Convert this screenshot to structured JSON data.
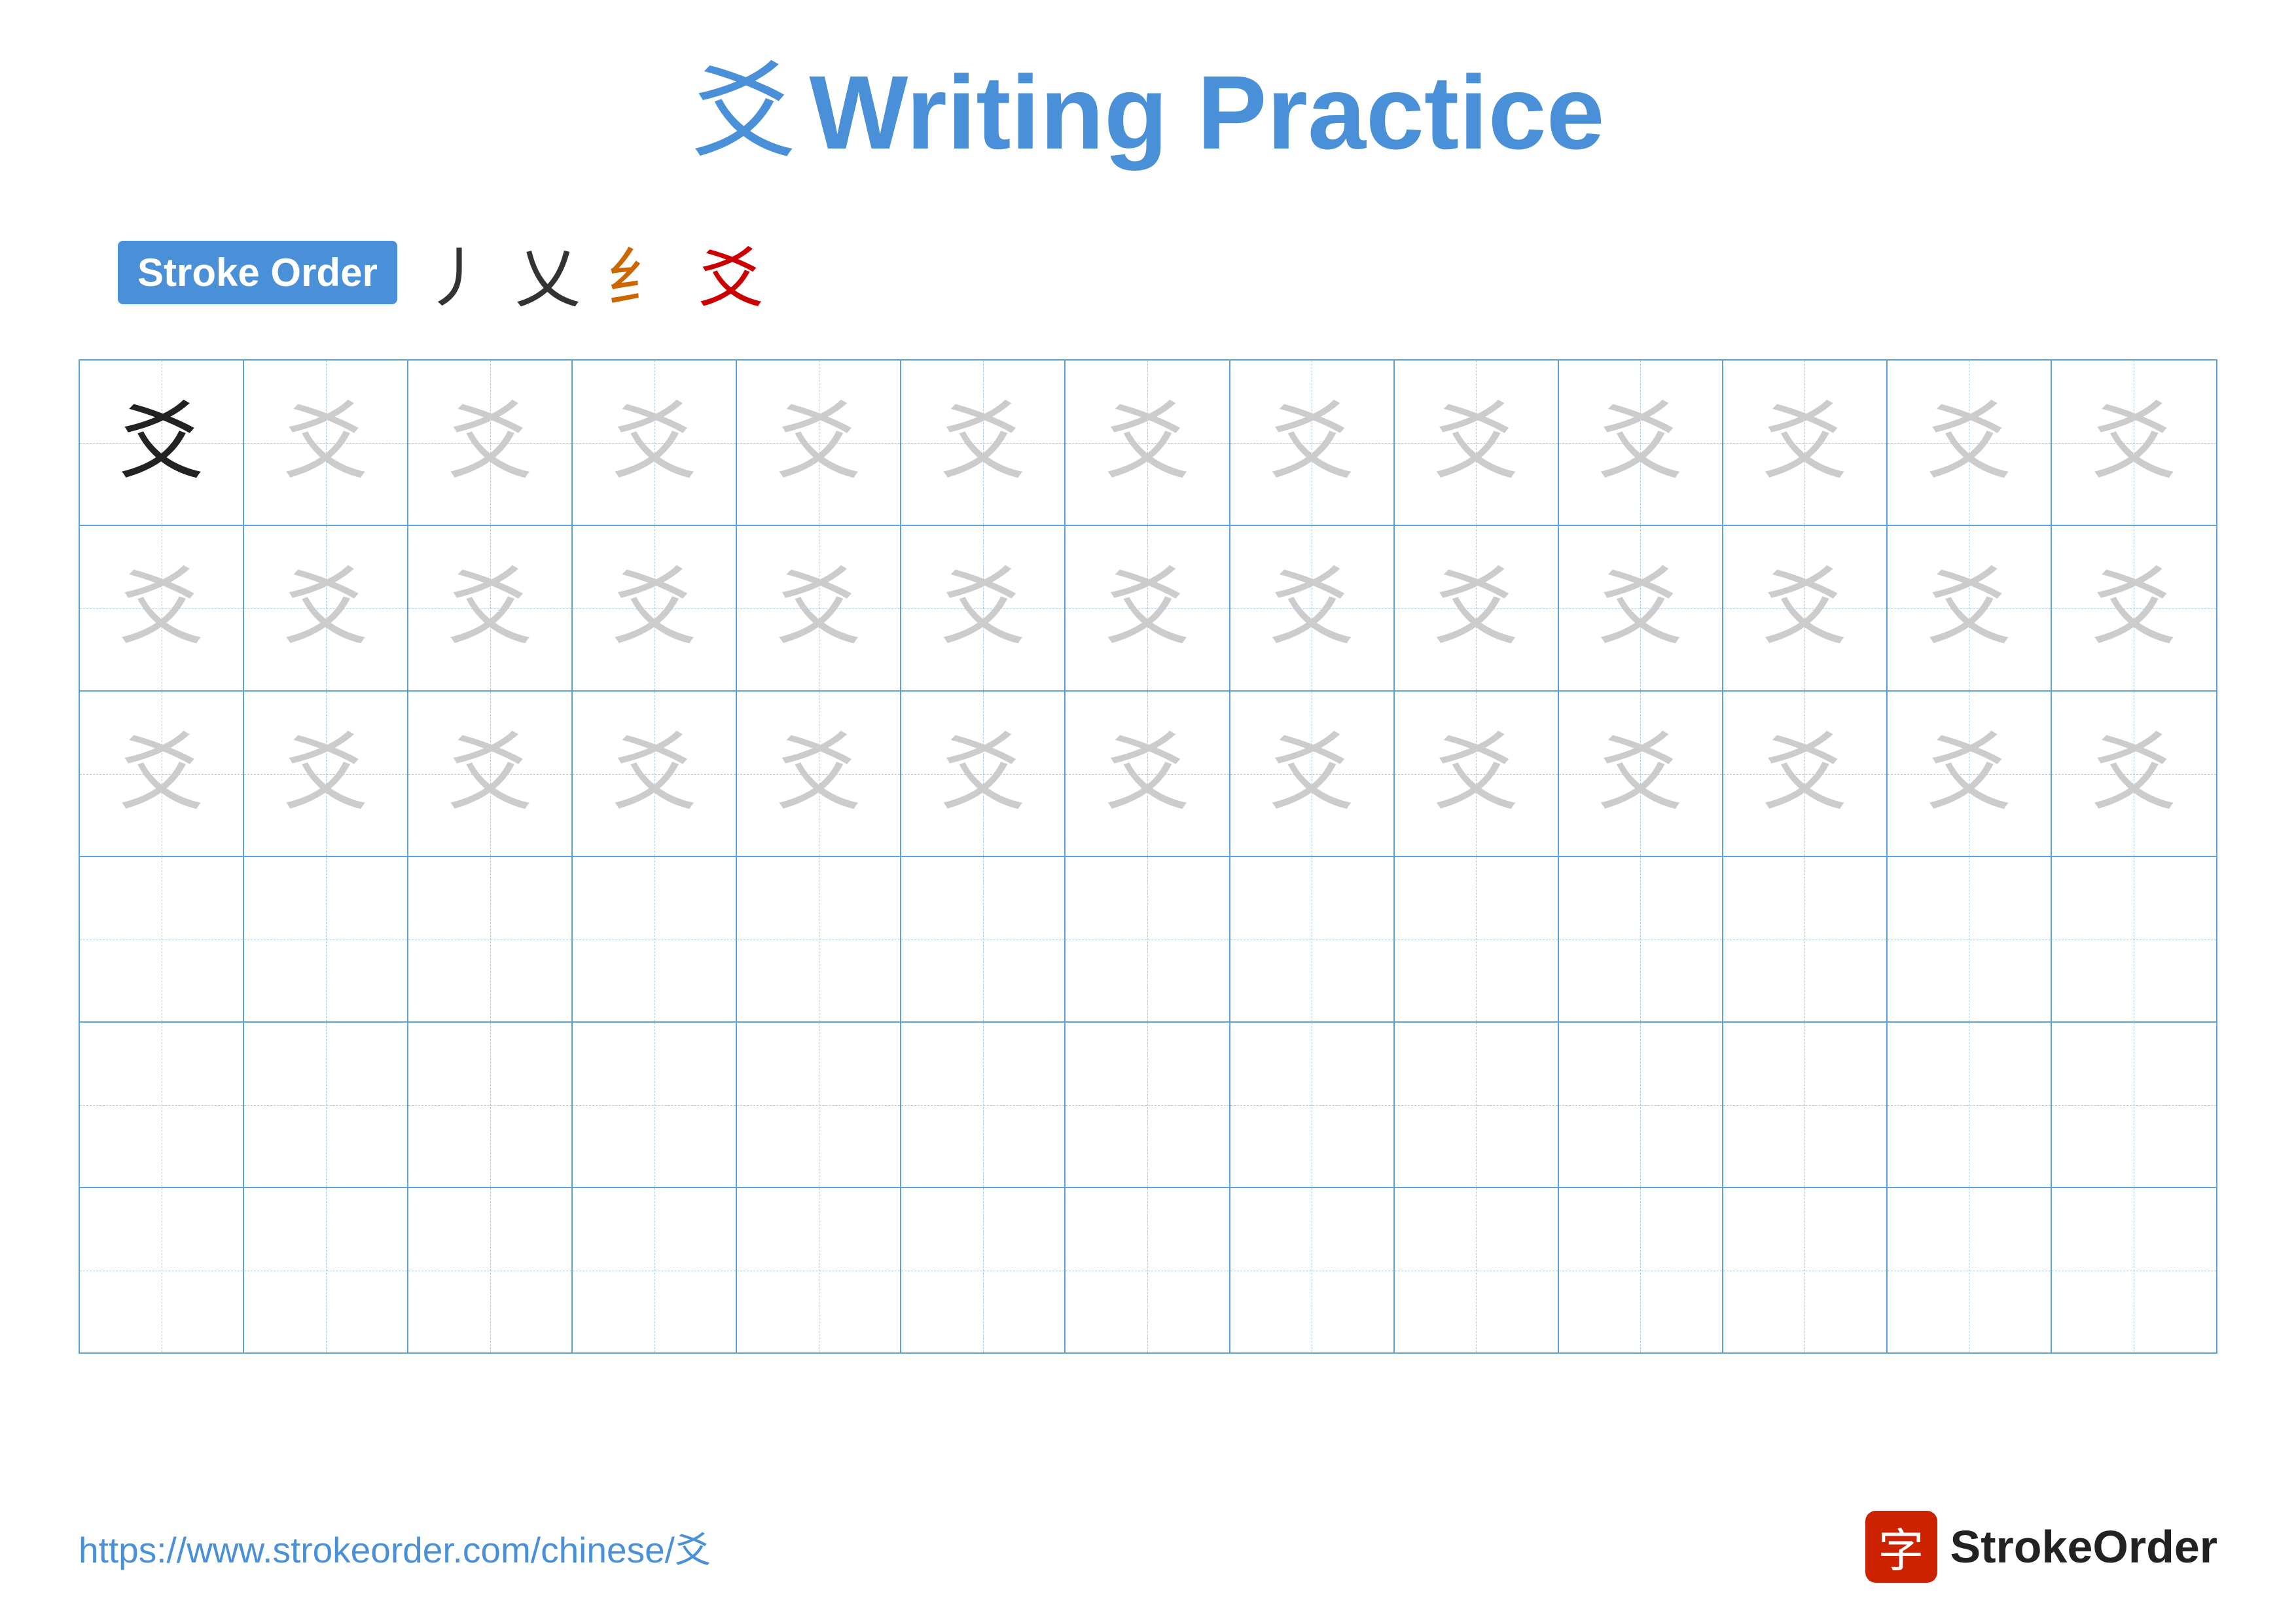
{
  "title": {
    "character": "爻",
    "text": "Writing Practice"
  },
  "stroke_order": {
    "badge_label": "Stroke Order",
    "steps": [
      "丿",
      "乂",
      "纟",
      "爻"
    ]
  },
  "grid": {
    "rows": 6,
    "cols": 13,
    "character": "爻",
    "row_types": [
      "dark_then_light",
      "light",
      "light",
      "empty",
      "empty",
      "empty"
    ]
  },
  "footer": {
    "url": "https://www.strokeorder.com/chinese/爻",
    "logo_char": "字",
    "logo_text": "StrokeOrder"
  },
  "colors": {
    "primary_blue": "#4a90d9",
    "dark_char": "#222222",
    "light_char": "#cccccc",
    "red_stroke": "#cc0000",
    "grid_border": "#5ba3d9",
    "dashed_line": "#a8c8e8"
  }
}
